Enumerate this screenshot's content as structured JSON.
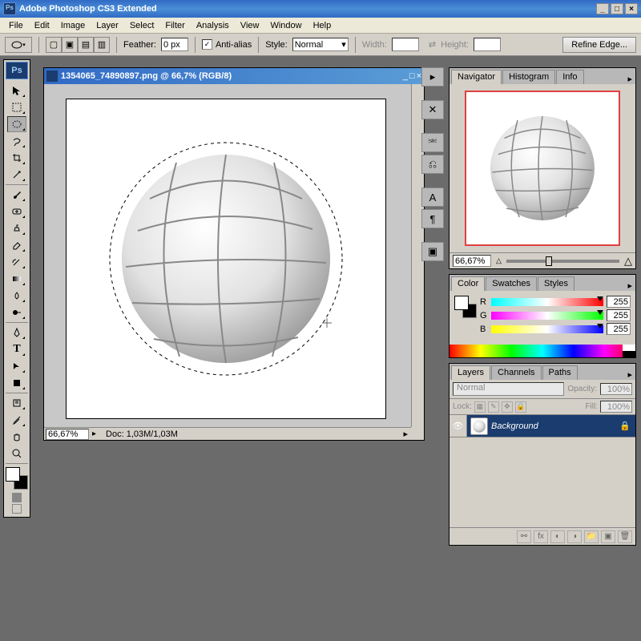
{
  "app": {
    "title": "Adobe Photoshop CS3 Extended"
  },
  "menu": [
    "File",
    "Edit",
    "Image",
    "Layer",
    "Select",
    "Filter",
    "Analysis",
    "View",
    "Window",
    "Help"
  ],
  "options": {
    "feather_label": "Feather:",
    "feather_value": "0 px",
    "antialias_label": "Anti-alias",
    "style_label": "Style:",
    "style_value": "Normal",
    "width_label": "Width:",
    "width_value": "",
    "height_label": "Height:",
    "height_value": "",
    "refine_label": "Refine Edge..."
  },
  "document": {
    "title": "1354065_74890897.png @ 66,7% (RGB/8)",
    "zoom": "66,67%",
    "status": "Doc: 1,03M/1,03M"
  },
  "navigator": {
    "tabs": [
      "Navigator",
      "Histogram",
      "Info"
    ],
    "zoom": "66,67%"
  },
  "color": {
    "tabs": [
      "Color",
      "Swatches",
      "Styles"
    ],
    "r_label": "R",
    "r_value": "255",
    "g_label": "G",
    "g_value": "255",
    "b_label": "B",
    "b_value": "255"
  },
  "layers": {
    "tabs": [
      "Layers",
      "Channels",
      "Paths"
    ],
    "blend_mode": "Normal",
    "opacity_label": "Opacity:",
    "opacity_value": "100%",
    "lock_label": "Lock:",
    "fill_label": "Fill:",
    "fill_value": "100%",
    "items": [
      {
        "name": "Background"
      }
    ]
  }
}
